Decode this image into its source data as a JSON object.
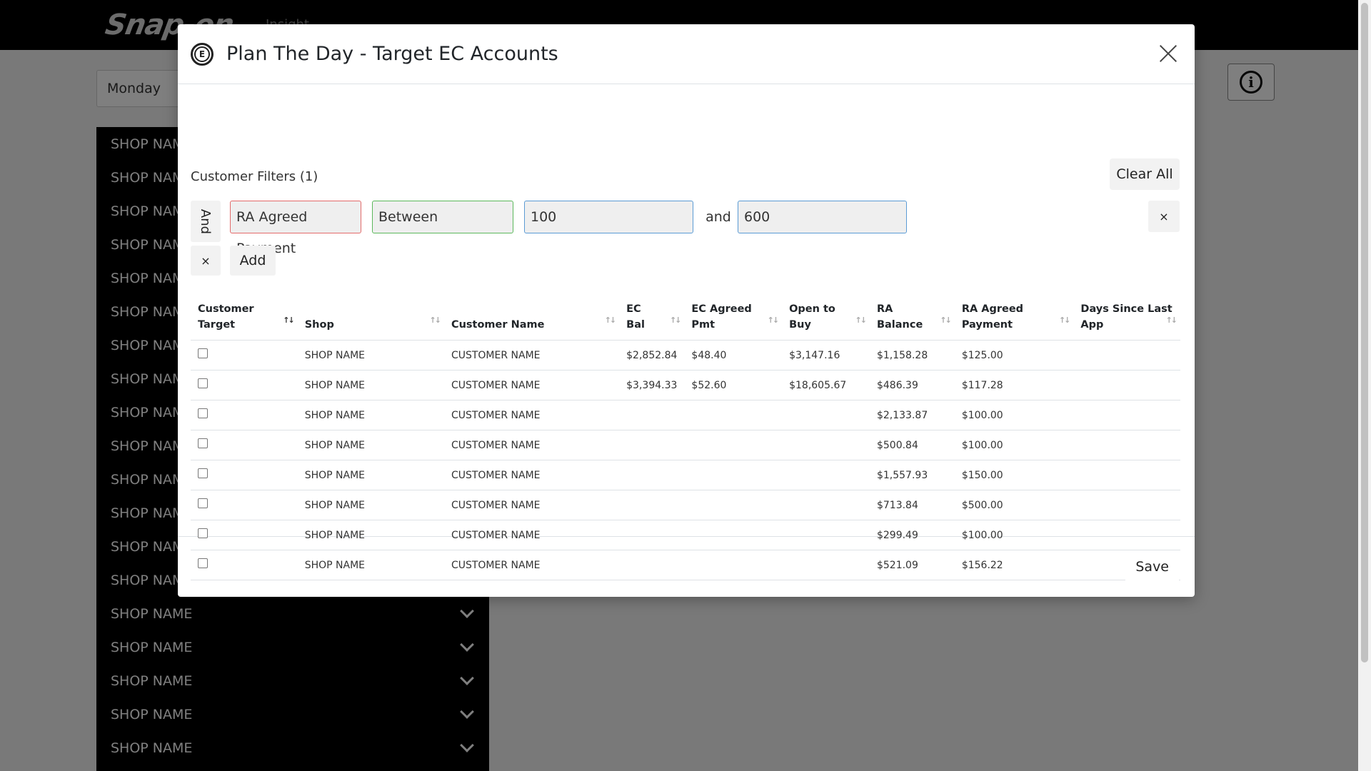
{
  "app": {
    "logo_text": "Snap-on",
    "logo_sub": "Insight",
    "day_select_value": "Monday",
    "shop_list": [
      "SHOP NAME",
      "SHOP NAME",
      "SHOP NAME",
      "SHOP NAME",
      "SHOP NAME",
      "SHOP NAME",
      "SHOP NAME",
      "SHOP NAME",
      "SHOP NAME",
      "SHOP NAME",
      "SHOP NAME",
      "SHOP NAME",
      "SHOP NAME",
      "SHOP NAME",
      "SHOP NAME",
      "SHOP NAME",
      "SHOP NAME",
      "SHOP NAME",
      "SHOP NAME"
    ]
  },
  "modal": {
    "title": "Plan The Day - Target EC Accounts",
    "filters_label": "Customer Filters (1)",
    "clear_all_label": "Clear All",
    "group_operator": "And",
    "filter": {
      "field": "RA Agreed Payment",
      "operator": "Between",
      "min": "100",
      "joiner": "and",
      "max": "600"
    },
    "remove_label": "×",
    "add_label": "Add",
    "save_label": "Save",
    "columns": [
      {
        "line1": "Customer",
        "line2": "Target"
      },
      {
        "line1": "",
        "line2": "Shop"
      },
      {
        "line1": "",
        "line2": "Customer Name"
      },
      {
        "line1": "EC",
        "line2": "Bal"
      },
      {
        "line1": "EC Agreed",
        "line2": "Pmt"
      },
      {
        "line1": "Open to",
        "line2": "Buy"
      },
      {
        "line1": "RA",
        "line2": "Balance"
      },
      {
        "line1": "RA Agreed",
        "line2": "Payment"
      },
      {
        "line1": "Days Since Last",
        "line2": "App"
      }
    ],
    "rows": [
      {
        "shop": "SHOP NAME",
        "customer": "CUSTOMER NAME",
        "ec_bal": "$2,852.84",
        "ec_pmt": "$48.40",
        "otb": "$3,147.16",
        "ra_bal": "$1,158.28",
        "ra_pmt": "$125.00",
        "days": ""
      },
      {
        "shop": "SHOP NAME",
        "customer": "CUSTOMER NAME",
        "ec_bal": "$3,394.33",
        "ec_pmt": "$52.60",
        "otb": "$18,605.67",
        "ra_bal": "$486.39",
        "ra_pmt": "$117.28",
        "days": ""
      },
      {
        "shop": "SHOP NAME",
        "customer": "CUSTOMER NAME",
        "ec_bal": "",
        "ec_pmt": "",
        "otb": "",
        "ra_bal": "$2,133.87",
        "ra_pmt": "$100.00",
        "days": ""
      },
      {
        "shop": "SHOP NAME",
        "customer": "CUSTOMER NAME",
        "ec_bal": "",
        "ec_pmt": "",
        "otb": "",
        "ra_bal": "$500.84",
        "ra_pmt": "$100.00",
        "days": ""
      },
      {
        "shop": "SHOP NAME",
        "customer": "CUSTOMER NAME",
        "ec_bal": "",
        "ec_pmt": "",
        "otb": "",
        "ra_bal": "$1,557.93",
        "ra_pmt": "$150.00",
        "days": ""
      },
      {
        "shop": "SHOP NAME",
        "customer": "CUSTOMER NAME",
        "ec_bal": "",
        "ec_pmt": "",
        "otb": "",
        "ra_bal": "$713.84",
        "ra_pmt": "$500.00",
        "days": ""
      },
      {
        "shop": "SHOP NAME",
        "customer": "CUSTOMER NAME",
        "ec_bal": "",
        "ec_pmt": "",
        "otb": "",
        "ra_bal": "$299.49",
        "ra_pmt": "$100.00",
        "days": ""
      },
      {
        "shop": "SHOP NAME",
        "customer": "CUSTOMER NAME",
        "ec_bal": "",
        "ec_pmt": "",
        "otb": "",
        "ra_bal": "$521.09",
        "ra_pmt": "$156.22",
        "days": ""
      }
    ]
  },
  "colors": {
    "field_border": "#e36a6a",
    "operator_border": "#5cb85c",
    "value_border": "#5b9bd5"
  }
}
